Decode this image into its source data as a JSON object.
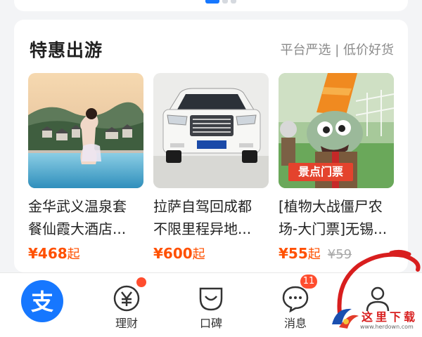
{
  "section": {
    "title": "特惠出游",
    "subtitle": "平台严选 | 低价好货"
  },
  "products": [
    {
      "name": "金华武义温泉套\n餐仙霞大酒店...",
      "price": "¥468",
      "price_suffix": "起"
    },
    {
      "name": "拉萨自驾回成都\n不限里程异地...",
      "price": "¥600",
      "price_suffix": "起"
    },
    {
      "name": "[植物大战僵尸农\n场-大门票]无锡...",
      "price": "¥55",
      "price_suffix": "起",
      "original_price": "¥59",
      "image_tag": "景点门票"
    }
  ],
  "tabbar": {
    "items": [
      {
        "label": "",
        "icon": "alipay-icon"
      },
      {
        "label": "理财",
        "icon": "yuan-icon",
        "badge": "dot"
      },
      {
        "label": "口碑",
        "icon": "smile-bag-icon"
      },
      {
        "label": "消息",
        "icon": "chat-icon",
        "badge": "11"
      },
      {
        "label": "",
        "icon": "user-icon"
      }
    ]
  },
  "watermark": {
    "text": "这里下载",
    "url": "www.herdown.com"
  },
  "colors": {
    "accent": "#1677ff",
    "price": "#ff5000",
    "badge": "#ff4d2e",
    "annotation": "#d81e1e"
  }
}
